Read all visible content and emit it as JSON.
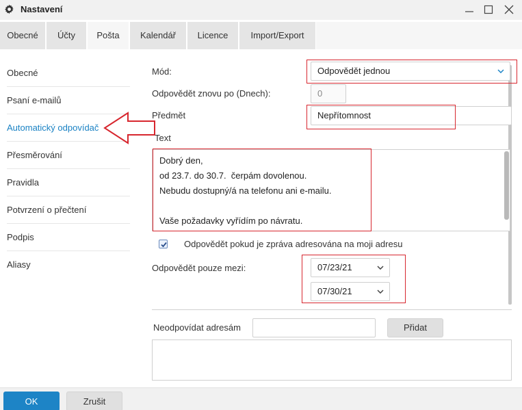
{
  "window": {
    "title": "Nastavení"
  },
  "tabs": [
    {
      "label": "Obecné"
    },
    {
      "label": "Účty"
    },
    {
      "label": "Pošta"
    },
    {
      "label": "Kalendář"
    },
    {
      "label": "Licence"
    },
    {
      "label": "Import/Export"
    }
  ],
  "active_tab": "Pošta",
  "sidebar": {
    "items": [
      {
        "label": "Obecné"
      },
      {
        "label": "Psaní e-mailů"
      },
      {
        "label": "Automatický odpovídač"
      },
      {
        "label": "Přesměrování"
      },
      {
        "label": "Pravidla"
      },
      {
        "label": "Potvrzení o přečtení"
      },
      {
        "label": "Podpis"
      },
      {
        "label": "Aliasy"
      }
    ],
    "active": "Automatický odpovídač"
  },
  "form": {
    "mode_label": "Mód:",
    "mode_value": "Odpovědět jednou",
    "reply_again_label": "Odpovědět znovu po (Dnech):",
    "reply_again_value": "0",
    "subject_label": "Předmět",
    "subject_value": "Nepřítomnost",
    "text_label": "Text",
    "text_lines": [
      "Dobrý den,",
      "od 23.7. do 30.7.  čerpám dovolenou.",
      "Nebudu dostupný/á na telefonu ani e-mailu.",
      "",
      "Vaše požadavky vyřídím po návratu."
    ],
    "only_to_me_label": "Odpovědět pokud je zpráva adresována na moji adresu",
    "only_to_me_checked": true,
    "between_label": "Odpovědět pouze mezi:",
    "date_from": "07/23/21",
    "date_to": "07/30/21",
    "no_reply_label": "Neodpovídat adresám",
    "no_reply_value": "",
    "add_button": "Přidat"
  },
  "footer": {
    "ok": "OK",
    "cancel": "Zrušit"
  },
  "colors": {
    "accent": "#1d84c6",
    "highlight": "#d7262e",
    "active_link": "#1a82c4"
  },
  "icons": {
    "title": "gear-icon",
    "minimize": "minimize-icon",
    "maximize": "maximize-icon",
    "close": "close-icon",
    "dropdown": "chevron-down-icon",
    "annotation": "arrow-left-icon"
  }
}
